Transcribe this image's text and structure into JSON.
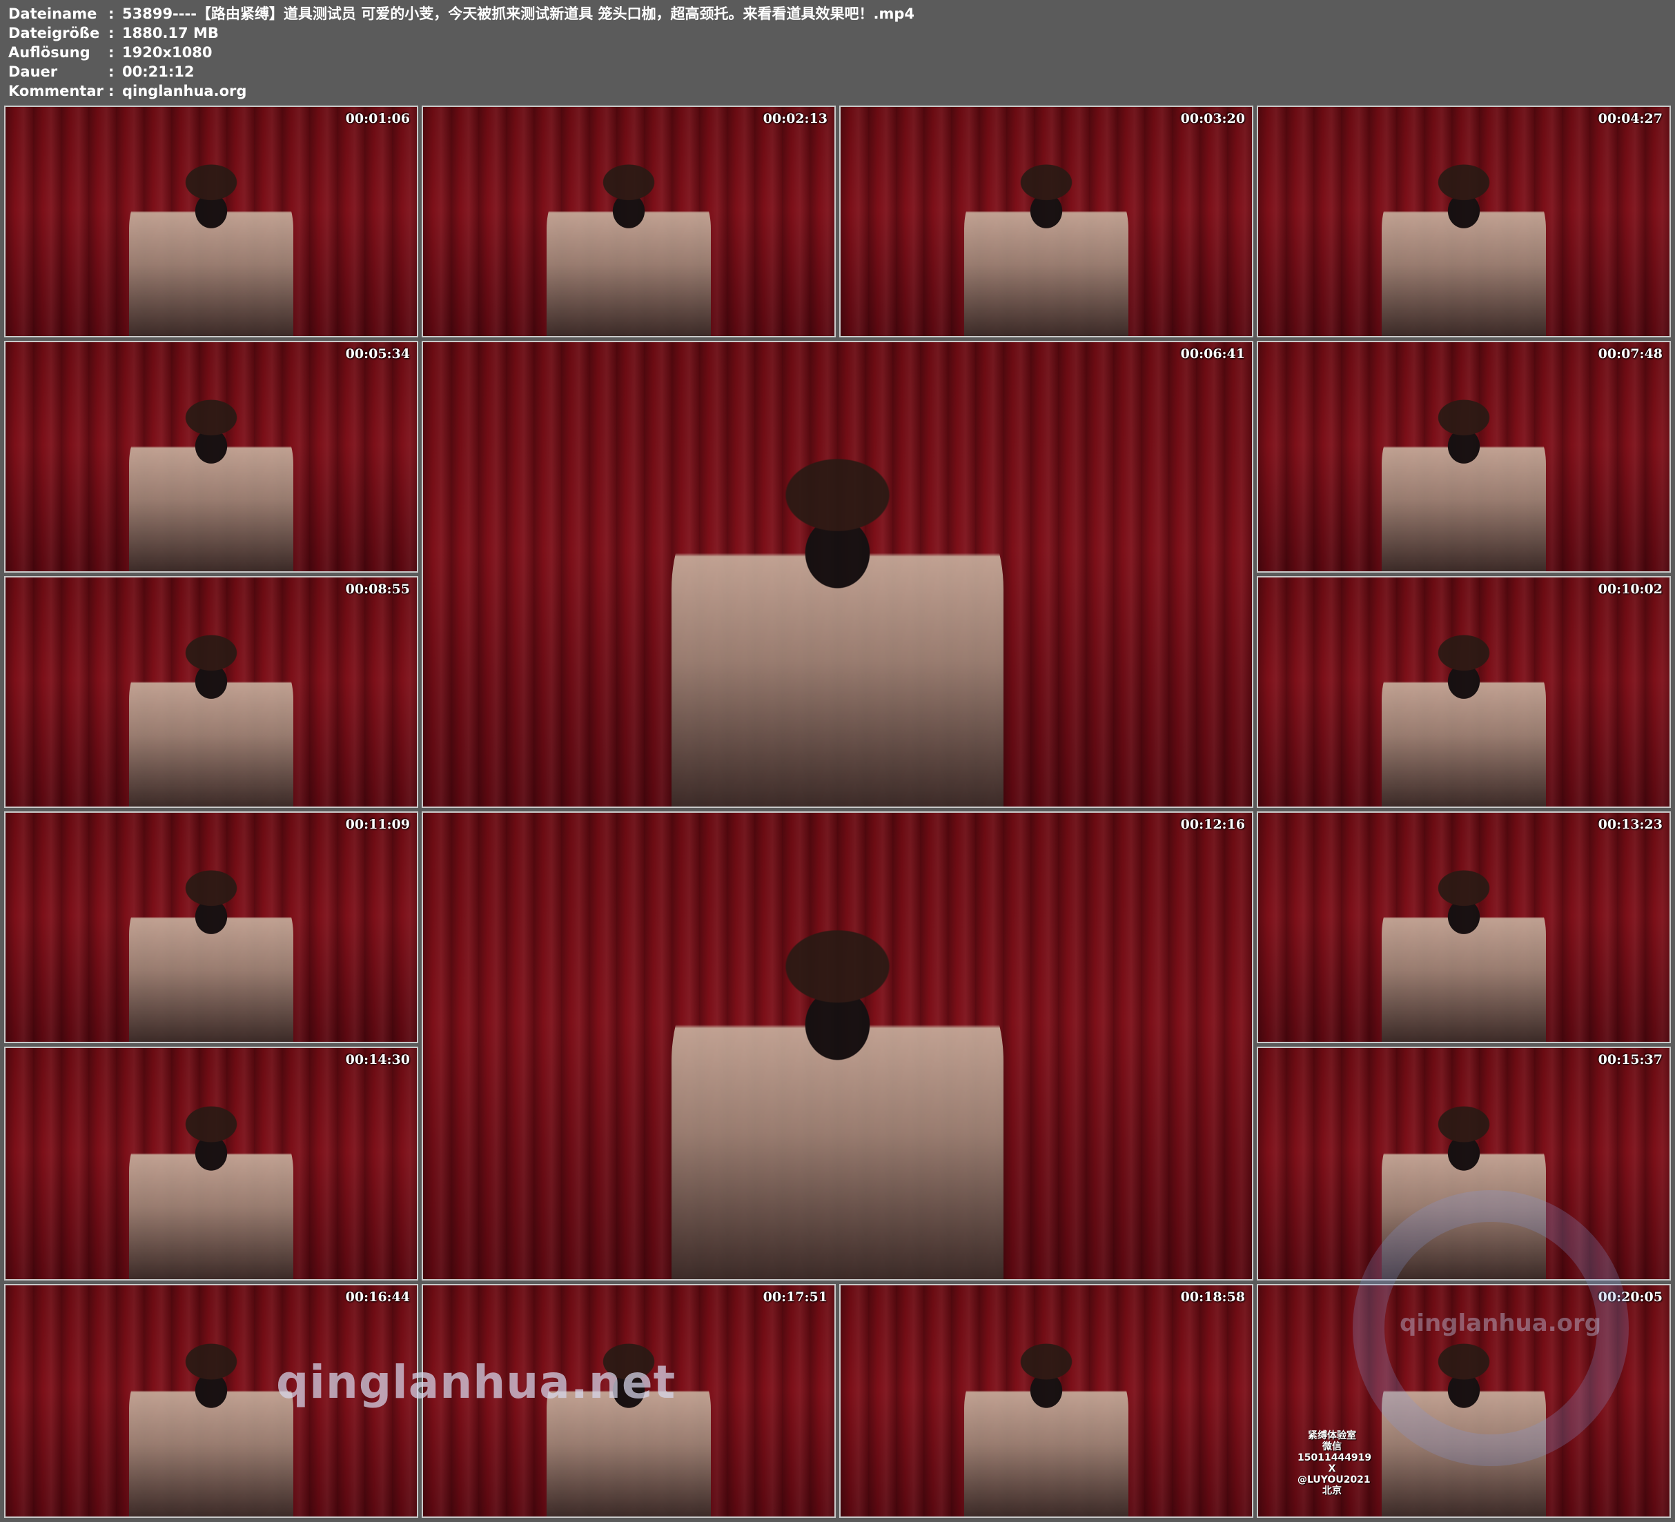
{
  "header": {
    "rows": [
      {
        "key": "Dateiname",
        "value": "53899----【路由紧缚】道具测试员 可爱的小芰，今天被抓来测试新道具 笼头口枷，超高颈托。来看看道具效果吧！.mp4"
      },
      {
        "key": "Dateigröße",
        "value": "1880.17 MB"
      },
      {
        "key": "Auflösung",
        "value": "1920x1080"
      },
      {
        "key": "Dauer",
        "value": "00:21:12"
      },
      {
        "key": "Kommentar",
        "value": "qinglanhua.org"
      }
    ],
    "separator": ":"
  },
  "thumbnails": [
    {
      "time": "00:01:06"
    },
    {
      "time": "00:02:13"
    },
    {
      "time": "00:03:20"
    },
    {
      "time": "00:04:27"
    },
    {
      "time": "00:05:34"
    },
    {
      "time": "00:06:41"
    },
    {
      "time": "00:07:48"
    },
    {
      "time": "00:08:55"
    },
    {
      "time": "00:10:02"
    },
    {
      "time": "00:11:09"
    },
    {
      "time": "00:12:16"
    },
    {
      "time": "00:13:23"
    },
    {
      "time": "00:14:30"
    },
    {
      "time": "00:15:37"
    },
    {
      "time": "00:16:44"
    },
    {
      "time": "00:17:51"
    },
    {
      "time": "00:18:58"
    },
    {
      "time": "00:20:05"
    }
  ],
  "watermarks": {
    "center": "qinglanhua.net",
    "corner": "qinglanhua.org",
    "stamp_lines": [
      "紧缚体验室",
      "微信 15011444919",
      "X @LUYOU2021",
      "北京"
    ]
  },
  "colors": {
    "background": "#5b5b5b",
    "header_text": "#ffffff",
    "curtain": "#7d0f18",
    "tile_border": "#c9c9c9"
  }
}
